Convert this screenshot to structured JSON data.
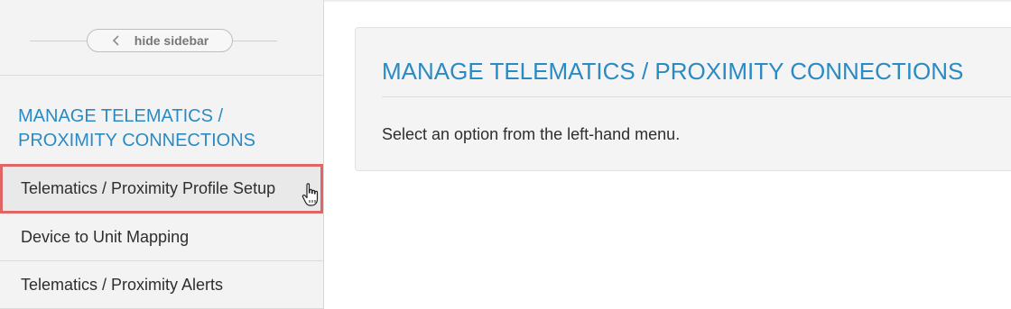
{
  "sidebar": {
    "hide_label": "hide sidebar",
    "section_title": "MANAGE TELEMATICS / PROXIMITY CONNECTIONS",
    "items": [
      {
        "label": "Telematics / Proximity Profile Setup",
        "highlighted": true
      },
      {
        "label": "Device to Unit Mapping"
      },
      {
        "label": "Telematics / Proximity Alerts"
      }
    ]
  },
  "main": {
    "title": "MANAGE TELEMATICS / PROXIMITY CONNECTIONS",
    "message": "Select an option from the left-hand menu."
  },
  "colors": {
    "accent": "#2a8bc4",
    "highlight_border": "#e06666",
    "sidebar_bg": "#f3f3f3",
    "panel_bg": "#f4f4f4"
  },
  "icons": {
    "hide_button": "chevron-left-icon",
    "cursor": "hand-pointer-icon"
  }
}
